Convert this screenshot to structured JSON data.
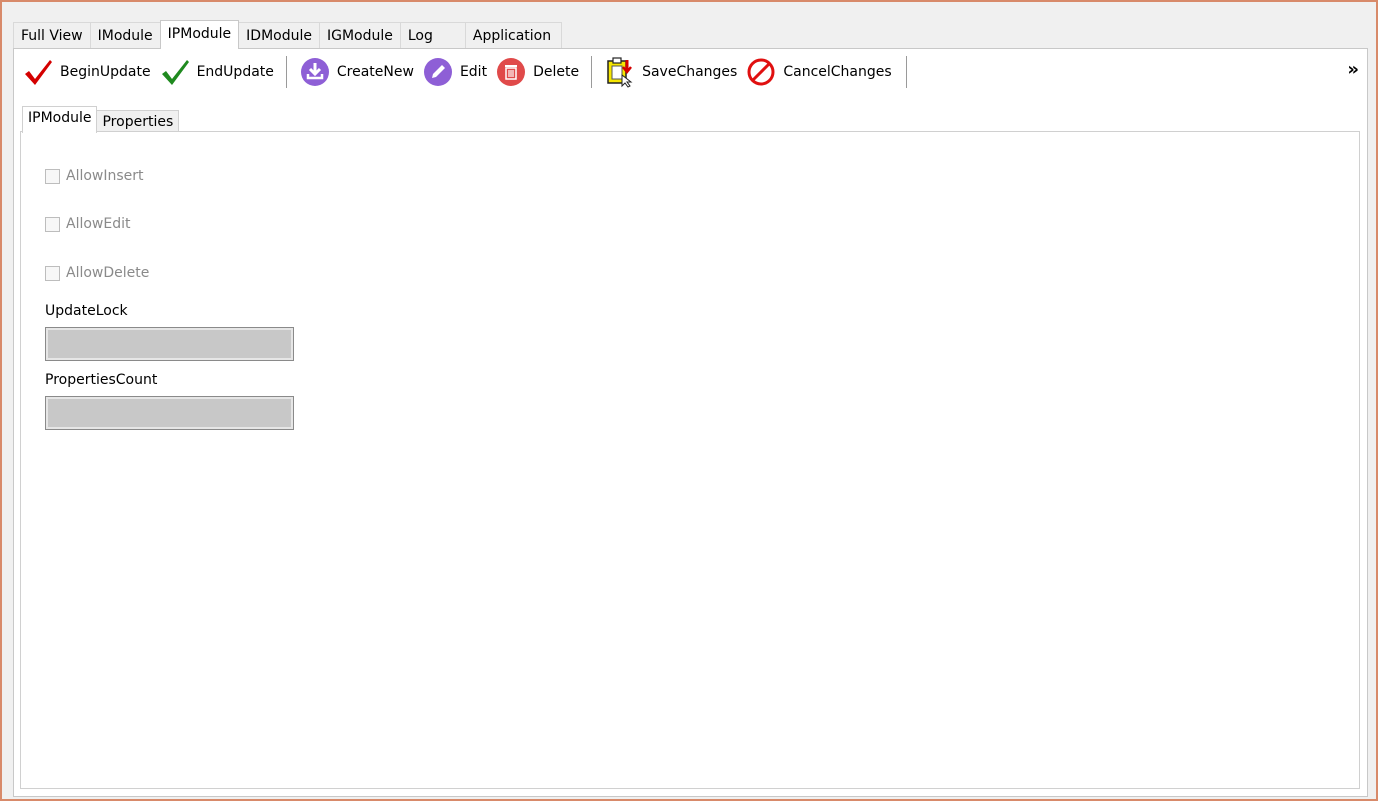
{
  "top_tabs": [
    {
      "label": "Full View"
    },
    {
      "label": "IModule"
    },
    {
      "label": "IPModule"
    },
    {
      "label": "IDModule"
    },
    {
      "label": "IGModule"
    },
    {
      "label": "Log"
    },
    {
      "label": "Application"
    }
  ],
  "active_top_tab": "IPModule",
  "toolbar": {
    "begin_update": "BeginUpdate",
    "end_update": "EndUpdate",
    "create_new": "CreateNew",
    "edit": "Edit",
    "delete": "Delete",
    "save_changes": "SaveChanges",
    "cancel_changes": "CancelChanges",
    "overflow": "»"
  },
  "icons": {
    "begin_update": "checkmark-red-icon",
    "end_update": "checkmark-green-icon",
    "create_new": "download-circle-icon",
    "edit": "pencil-circle-icon",
    "delete": "trash-circle-icon",
    "save_changes": "clipboard-save-icon",
    "cancel_changes": "prohibited-circle-icon"
  },
  "colors": {
    "check_red": "#d40000",
    "check_green": "#1f8a1f",
    "purple": "#8e5fd6",
    "delete_red": "#e04a4a",
    "cancel_red": "#e01010",
    "save_yellow": "#f6e600"
  },
  "inner_tabs": [
    {
      "label": "IPModule"
    },
    {
      "label": "Properties"
    }
  ],
  "active_inner_tab": "IPModule",
  "form": {
    "allow_insert": {
      "label": "AllowInsert",
      "checked": false
    },
    "allow_edit": {
      "label": "AllowEdit",
      "checked": false
    },
    "allow_delete": {
      "label": "AllowDelete",
      "checked": false
    },
    "update_lock": {
      "label": "UpdateLock",
      "value": ""
    },
    "properties_count": {
      "label": "PropertiesCount",
      "value": ""
    }
  }
}
